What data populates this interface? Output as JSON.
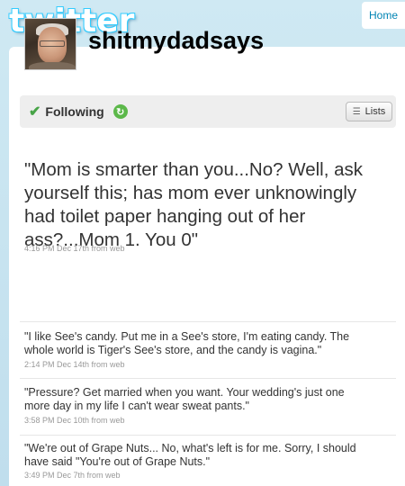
{
  "header": {
    "logo_text": "twitter",
    "home_label": "Home"
  },
  "profile": {
    "username": "shitmydadsays",
    "avatar_icon": "profile-photo"
  },
  "actions": {
    "following_label": "Following",
    "lists_label": "Lists"
  },
  "featured_tweet": {
    "text": "\"Mom is smarter than you...No? Well, ask yourself this; has mom ever unknowingly had toilet paper hanging out of her ass?...Mom 1. You 0\"",
    "meta": "4:16 PM Dec 17th from web"
  },
  "tweets": [
    {
      "text": "\"I like See's candy. Put me in a See's store, I'm eating candy. The whole world is Tiger's See's store, and the candy is vagina.\"",
      "meta": "2:14 PM Dec 14th from web"
    },
    {
      "text": "\"Pressure? Get married when you want. Your wedding's just one more day in my life I can't wear sweat pants.\"",
      "meta": "3:58 PM Dec 10th from web"
    },
    {
      "text": "\"We're out of Grape Nuts... No, what's left is for me. Sorry, I should have said \"You're out of Grape Nuts.\"",
      "meta": "3:49 PM Dec 7th from web"
    }
  ],
  "colors": {
    "background": "#c0deed",
    "link": "#0084b4",
    "following_check": "#47a447"
  }
}
